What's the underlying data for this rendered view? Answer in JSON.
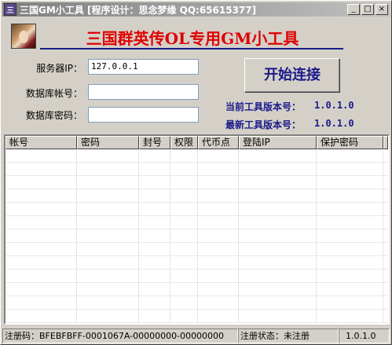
{
  "window": {
    "title": "三国GM小工具 [程序设计：思念梦缘 QQ:65615377]",
    "icon": "app-icon",
    "buttons": {
      "minimize": "_",
      "maximize": "□",
      "close": "×"
    }
  },
  "header": {
    "app_title": "三国群英传OL专用GM小工具",
    "avatar": "character-portrait"
  },
  "form": {
    "server_ip_label": "服务器IP：",
    "server_ip_value": "127.0.0.1",
    "db_account_label": "数据库帐号：",
    "db_account_value": "",
    "db_password_label": "数据库密码：",
    "db_password_value": ""
  },
  "connect_button": "开始连接",
  "version": {
    "current_label": "当前工具版本号：",
    "current_value": "1.0.1.0",
    "latest_label": "最新工具版本号：",
    "latest_value": "1.0.1.0"
  },
  "table": {
    "columns": [
      "帐号",
      "密码",
      "封号",
      "权限",
      "代币点",
      "登陆IP",
      "保护密码"
    ],
    "rows": []
  },
  "status": {
    "reg_code": "注册码：BFEBFBFF-0001067A-00000000-00000000",
    "reg_state": "注册状态：未注册",
    "version": "1.0.1.0"
  },
  "colors": {
    "heading": "#e00000",
    "accent": "#1a1a8a",
    "face": "#d4d0c8"
  }
}
